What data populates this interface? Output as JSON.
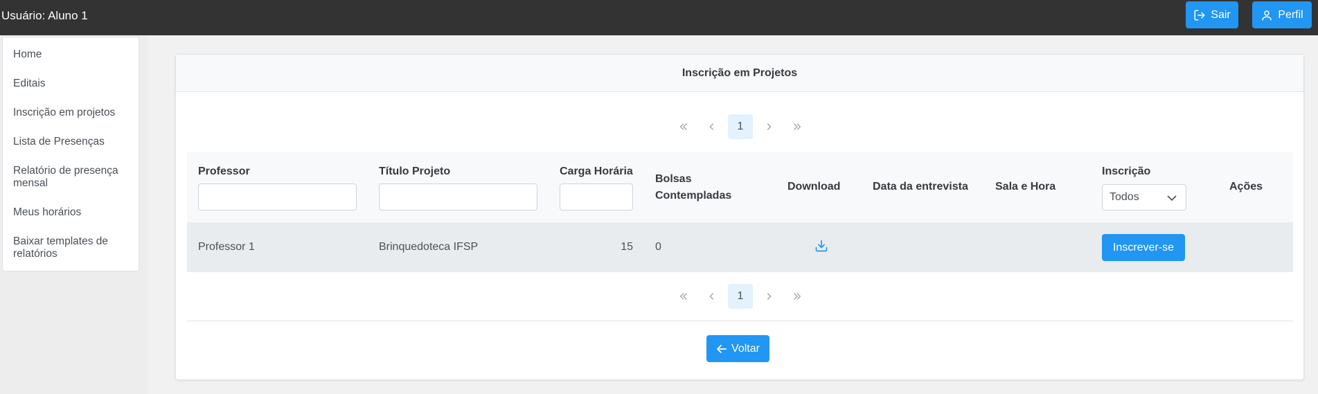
{
  "header": {
    "user_label": "Usuário: Aluno 1",
    "logout_label": "Sair",
    "profile_label": "Perfil"
  },
  "sidebar": {
    "items": [
      {
        "label": "Home"
      },
      {
        "label": "Editais"
      },
      {
        "label": "Inscrição em projetos"
      },
      {
        "label": "Lista de Presenças"
      },
      {
        "label": "Relatório de presença mensal"
      },
      {
        "label": "Meus horários"
      },
      {
        "label": "Baixar templates de relatórios"
      }
    ]
  },
  "card": {
    "title": "Inscrição em Projetos",
    "back_label": "Voltar"
  },
  "paginator": {
    "current_page": "1"
  },
  "table": {
    "columns": {
      "professor": "Professor",
      "titulo": "Título Projeto",
      "carga": "Carga Horária",
      "bolsas": "Bolsas Contempladas",
      "download": "Download",
      "data_entrevista": "Data da entrevista",
      "sala_hora": "Sala e Hora",
      "inscricao": "Inscrição",
      "acoes": "Ações"
    },
    "filters": {
      "inscricao_selected": "Todos"
    },
    "rows": [
      {
        "professor": "Professor 1",
        "titulo": "Brinquedoteca IFSP",
        "carga": "15",
        "bolsas": "0",
        "action_label": "Inscrever-se"
      }
    ]
  },
  "colors": {
    "topbar": "#333333",
    "primary": "#2196f3",
    "row_bg": "#e9ecef",
    "header_bg": "#f8f9fa"
  }
}
